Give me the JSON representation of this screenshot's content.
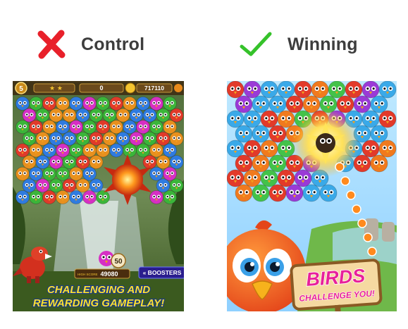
{
  "labels": {
    "control": "Control",
    "winning": "Winning"
  },
  "control_ad": {
    "hud": {
      "level": "5",
      "score": "0",
      "coins": "717110"
    },
    "bottom_hud": {
      "balls_left": "50",
      "high_score_label": "HIGH SCORE",
      "high_score": "49080",
      "boosters_button": "« BOOSTERS"
    },
    "tagline_line1": "CHALLENGING AND",
    "tagline_line2": "REWARDING GAMEPLAY!"
  },
  "winning_ad": {
    "sign_line1": "BIRDS",
    "sign_line2": "CHALLENGE YOU!"
  },
  "colors": {
    "cross": "#e8202a",
    "check": "#35c22a",
    "tagline_fill": "#ffe22b",
    "sign_title": "#e8219a",
    "sign_board": "#f5d9a1"
  },
  "icons": [
    "cross-icon",
    "check-icon"
  ]
}
